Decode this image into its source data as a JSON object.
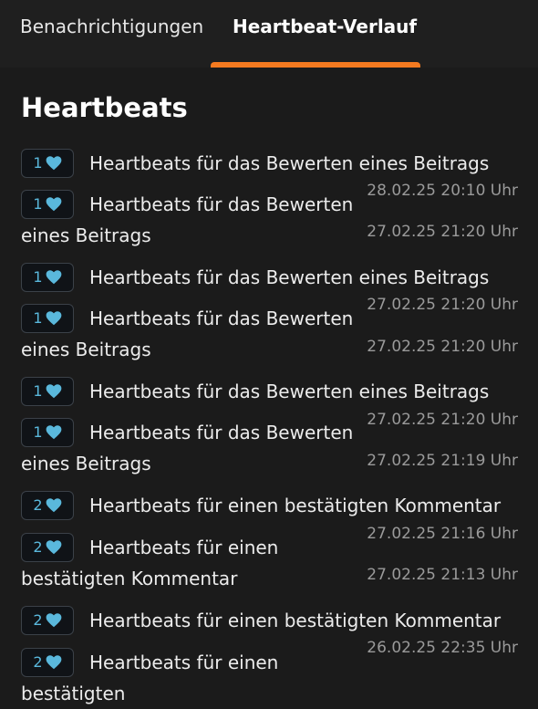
{
  "tabs": [
    {
      "label": "Benachrichtigungen",
      "active": false
    },
    {
      "label": "Heartbeat-Verlauf",
      "active": true
    }
  ],
  "section_title": "Heartbeats",
  "colors": {
    "background": "#1b1b1b",
    "accent": "#f47a20",
    "badge_heart": "#5ab8dc",
    "timestamp": "#9a9a9a"
  },
  "entries": [
    {
      "count": "1",
      "text": "Heartbeats für das Bewerten eines Beitrags",
      "icon": "heart-icon"
    },
    {
      "count": "1",
      "text": "Heartbeats für das Bewerten eines Beitrags",
      "icon": "heart-icon"
    },
    {
      "count": "1",
      "text": "Heartbeats für das Bewerten eines Beitrags",
      "icon": "heart-icon"
    },
    {
      "count": "1",
      "text": "Heartbeats für das Bewerten eines Beitrags",
      "icon": "heart-icon"
    },
    {
      "count": "1",
      "text": "Heartbeats für das Bewerten eines Beitrags",
      "icon": "heart-icon"
    },
    {
      "count": "1",
      "text": "Heartbeats für das Bewerten eines Beitrags",
      "icon": "heart-icon"
    },
    {
      "count": "2",
      "text": "Heartbeats für einen bestätigten Kommentar",
      "icon": "heart-icon"
    },
    {
      "count": "2",
      "text": "Heartbeats für einen bestätigten Kommentar",
      "icon": "heart-icon"
    },
    {
      "count": "2",
      "text": "Heartbeats für einen bestätigten Kommentar",
      "icon": "heart-icon"
    },
    {
      "count": "2",
      "text": "Heartbeats für einen bestätigten",
      "icon": "heart-icon"
    }
  ],
  "timestamps": [
    "28.02.25 20:10 Uhr",
    "27.02.25 21:20 Uhr",
    "27.02.25 21:20 Uhr",
    "27.02.25 21:20 Uhr",
    "27.02.25 21:20 Uhr",
    "27.02.25 21:19 Uhr",
    "27.02.25 21:16 Uhr",
    "27.02.25 21:13 Uhr",
    "26.02.25 22:35 Uhr"
  ]
}
